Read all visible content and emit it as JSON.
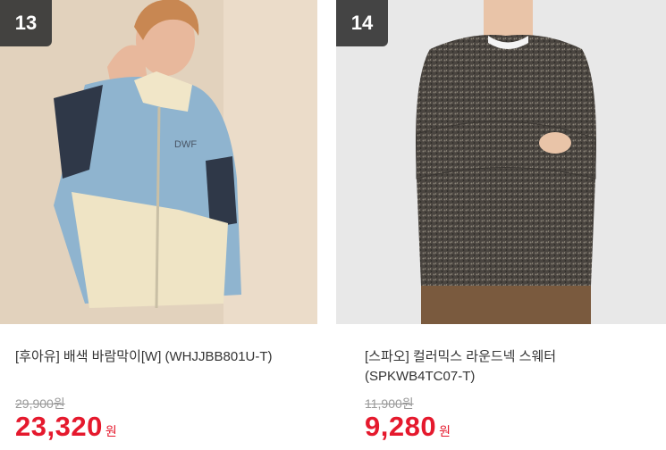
{
  "products": [
    {
      "rank": "13",
      "title": "[후아유] 배색 바람막이[W] (WHJJBB801U-T)",
      "original_price": "29,900원",
      "sale_price": "23,320",
      "currency": "원",
      "image_label": "DWF"
    },
    {
      "rank": "14",
      "title": "[스파오] 컬러믹스 라운드넥 스웨터 (SPKWB4TC07-T)",
      "original_price": "11,900원",
      "sale_price": "9,280",
      "currency": "원"
    }
  ],
  "colors": {
    "sale_red": "#e5192d",
    "badge_bg": "#323232",
    "muted": "#999999"
  }
}
